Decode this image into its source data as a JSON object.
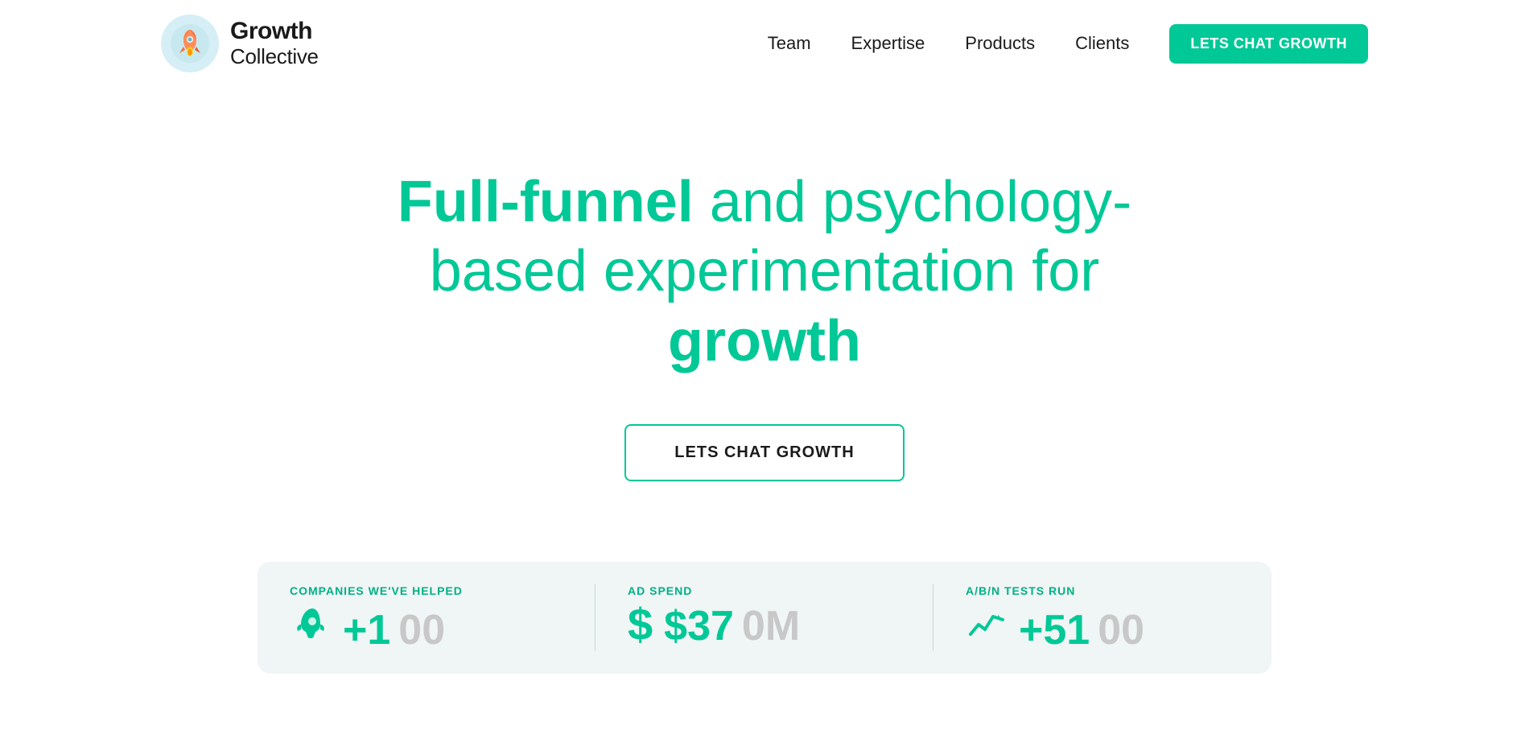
{
  "brand": {
    "name": "Growth",
    "subtitle": "Collective",
    "logo_alt": "Growth Collective logo"
  },
  "nav": {
    "links": [
      {
        "id": "team",
        "label": "Team"
      },
      {
        "id": "expertise",
        "label": "Expertise"
      },
      {
        "id": "products",
        "label": "Products"
      },
      {
        "id": "clients",
        "label": "Clients"
      }
    ],
    "cta_label": "LETS CHAT GROWTH"
  },
  "hero": {
    "headline_part1": "Full-funnel",
    "headline_part2": " and psychology-based experimentation for ",
    "headline_part3": "growth",
    "cta_label": "LETS CHAT GROWTH"
  },
  "stats": [
    {
      "id": "companies",
      "label": "COMPANIES WE'VE HELPED",
      "value": "+100",
      "icon": "rocket"
    },
    {
      "id": "ad-spend",
      "label": "AD SPEND",
      "value": "$370M",
      "icon": "dollar"
    },
    {
      "id": "ab-tests",
      "label": "A/B/n TESTS RUN",
      "value": "+5100",
      "icon": "chart"
    }
  ],
  "colors": {
    "brand_green": "#00c896",
    "dark_green": "#00b085",
    "text_dark": "#1a1a1a",
    "bg_light": "#f0f5f5"
  }
}
